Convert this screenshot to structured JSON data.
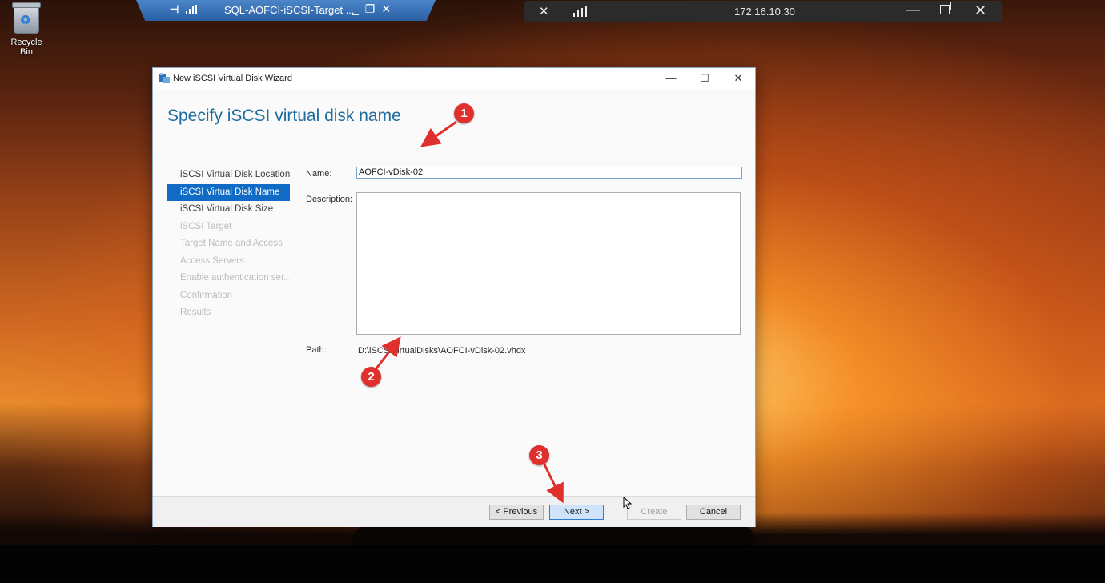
{
  "desktop": {
    "recycle_bin_label": "Recycle Bin"
  },
  "rdp_bar": {
    "title": "SQL-AOFCI-iSCSI-Target ...",
    "pin_icon": "pin-icon",
    "buttons": [
      "minimize",
      "restore",
      "close"
    ]
  },
  "remote_bar": {
    "ip": "172.16.10.30"
  },
  "wizard": {
    "window_title": "New iSCSI Virtual Disk Wizard",
    "heading": "Specify iSCSI virtual disk name",
    "steps": [
      {
        "label": "iSCSI Virtual Disk Location",
        "state": "done"
      },
      {
        "label": "iSCSI Virtual Disk Name",
        "state": "active"
      },
      {
        "label": "iSCSI Virtual Disk Size",
        "state": "enabled"
      },
      {
        "label": "iSCSI Target",
        "state": "disabled"
      },
      {
        "label": "Target Name and Access",
        "state": "disabled"
      },
      {
        "label": "Access Servers",
        "state": "disabled"
      },
      {
        "label": "Enable authentication ser...",
        "state": "disabled"
      },
      {
        "label": "Confirmation",
        "state": "disabled"
      },
      {
        "label": "Results",
        "state": "disabled"
      }
    ],
    "name_label": "Name:",
    "name_value": "AOFCI-vDisk-02",
    "description_label": "Description:",
    "description_value": "",
    "path_label": "Path:",
    "path_value": "D:\\iSCSIVirtualDisks\\AOFCI-vDisk-02.vhdx",
    "buttons": {
      "previous": "< Previous",
      "next": "Next >",
      "create": "Create",
      "cancel": "Cancel"
    }
  },
  "annotations": [
    "1",
    "2",
    "3"
  ],
  "colors": {
    "heading": "#1f6c9e",
    "active_step": "#0f6bc4",
    "badge": "#e0302d",
    "rdp_bar": "#3a72b8"
  }
}
